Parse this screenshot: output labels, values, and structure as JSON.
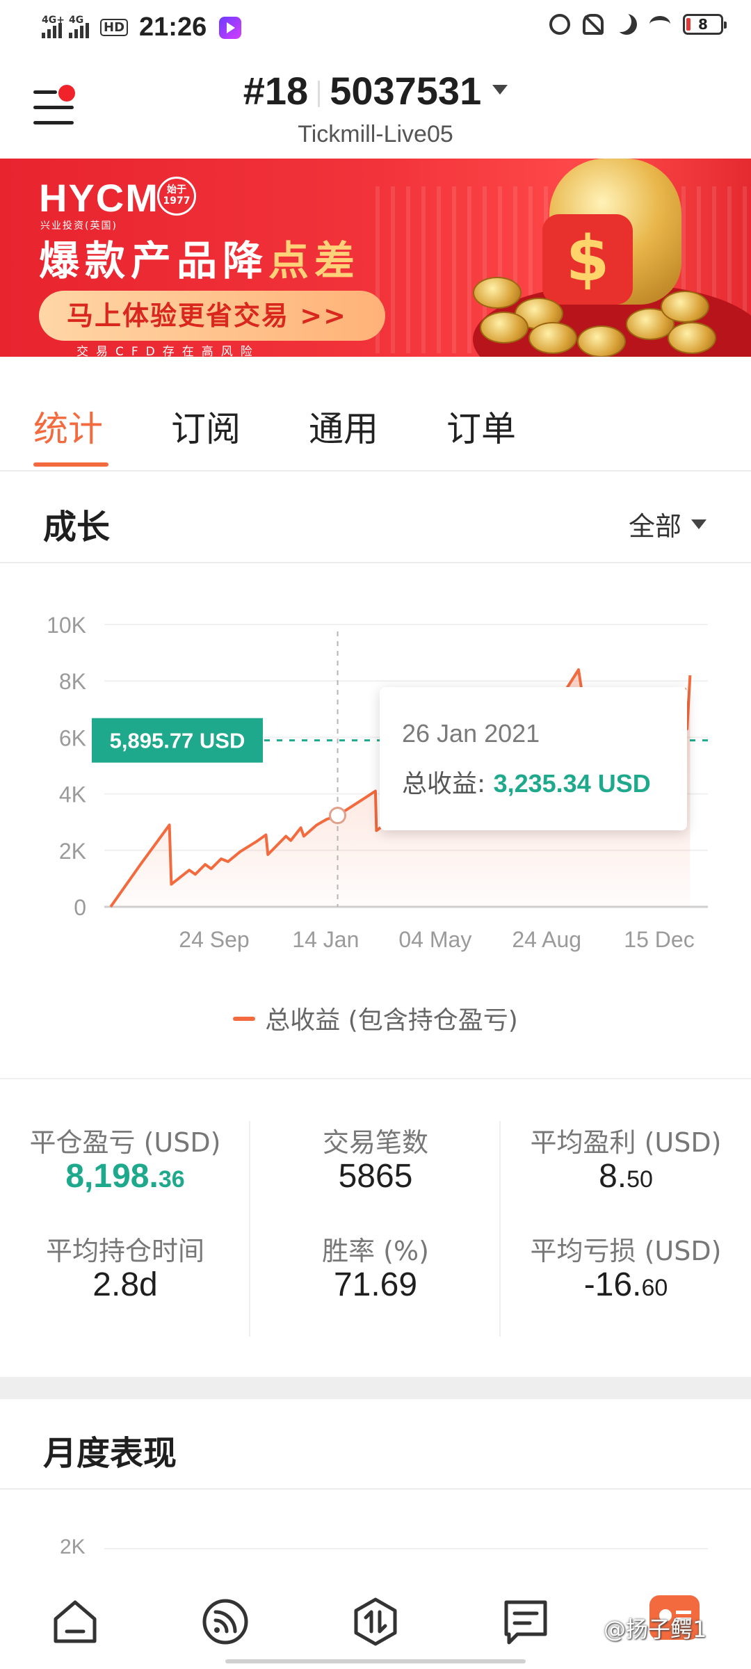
{
  "status_bar": {
    "signal1": "4G+",
    "signal2": "4G",
    "hd": "HD",
    "time": "21:26",
    "battery": "8"
  },
  "header": {
    "account_prefix": "#18",
    "account_suffix": "5037531",
    "server": "Tickmill-Live05"
  },
  "banner": {
    "logo": "HYCM",
    "logo_sub": "兴业投资(英国)",
    "seal": "始于 1977",
    "title_main": "爆款产品降",
    "title_highlight": "点差",
    "cta": "马上体验更省交易 >>",
    "risk": "交易CFD存在高风险"
  },
  "tabs": [
    {
      "label": "统计",
      "active": true
    },
    {
      "label": "订阅",
      "active": false
    },
    {
      "label": "通用",
      "active": false
    },
    {
      "label": "订单",
      "active": false
    }
  ],
  "growth": {
    "title": "成长",
    "filter": "全部",
    "reference_label": "5,895.77 USD",
    "tooltip_date": "26 Jan 2021",
    "tooltip_label": "总收益:",
    "tooltip_value": "3,235.34 USD",
    "legend": "总收益 (包含持仓盈亏)"
  },
  "chart_data": {
    "type": "line",
    "title": "",
    "xlabel": "",
    "ylabel": "",
    "x_ticks": [
      "24 Sep",
      "14 Jan",
      "04 May",
      "24 Aug",
      "15 Dec"
    ],
    "y_ticks": [
      "0",
      "2K",
      "4K",
      "6K",
      "8K",
      "10K"
    ],
    "ylim": [
      0,
      10000
    ],
    "series": [
      {
        "name": "总收益 (包含持仓盈亏)",
        "color": "#f26a3d",
        "x": [
          "2020-06-12",
          "2020-07-12",
          "2020-08-10",
          "2020-08-12",
          "2020-08-30",
          "2020-09-05",
          "2020-09-15",
          "2020-09-21",
          "2020-10-01",
          "2020-10-08",
          "2020-10-20",
          "2020-11-05",
          "2020-11-15",
          "2020-11-17",
          "2020-12-05",
          "2020-12-10",
          "2020-12-20",
          "2020-12-23",
          "2021-01-05",
          "2021-01-15",
          "2021-01-26",
          "2021-02-20",
          "2021-03-05",
          "2021-03-06",
          "2021-03-25",
          "2021-04-10",
          "2021-05-10",
          "2021-06-20",
          "2021-07-15",
          "2021-08-20",
          "2021-09-25",
          "2021-09-28",
          "2021-10-15",
          "2021-11-05",
          "2021-12-05",
          "2022-01-10",
          "2022-01-12",
          "2022-01-15"
        ],
        "values": [
          0,
          1500,
          2900,
          800,
          1300,
          1150,
          1500,
          1350,
          1700,
          1600,
          1950,
          2300,
          2550,
          1850,
          2500,
          2350,
          2800,
          2500,
          2900,
          3100,
          3235,
          3800,
          4100,
          2700,
          3200,
          3500,
          4300,
          4900,
          5600,
          6400,
          8400,
          7700,
          7400,
          7000,
          7300,
          7700,
          6300,
          8200
        ]
      }
    ],
    "reference_line": {
      "value": 5895.77,
      "label": "5,895.77 USD"
    },
    "highlight": {
      "x": "2021-01-26",
      "value": 3235.34
    },
    "grid": true,
    "legend_position": "bottom"
  },
  "stats": [
    {
      "label": "平仓盈亏 (USD)",
      "int": "8,198.",
      "dec": "36",
      "green": true
    },
    {
      "label": "交易笔数",
      "int": "5865",
      "dec": "",
      "green": false
    },
    {
      "label": "平均盈利 (USD)",
      "int": "8.",
      "dec": "50",
      "green": false
    },
    {
      "label": "平均持仓时间",
      "int": "2.8d",
      "dec": "",
      "green": false
    },
    {
      "label": "胜率 (%)",
      "int": "71.69",
      "dec": "",
      "green": false
    },
    {
      "label": "平均亏损 (USD)",
      "int": "-16.",
      "dec": "60",
      "green": false
    }
  ],
  "monthly": {
    "title": "月度表现",
    "first_tick": "2K"
  },
  "bottom_nav": [
    {
      "icon": "home-icon"
    },
    {
      "icon": "signal-feed-icon"
    },
    {
      "icon": "trade-icon"
    },
    {
      "icon": "messages-icon"
    },
    {
      "icon": "profile-card-icon"
    }
  ],
  "watermark": "@扬子鳄1"
}
